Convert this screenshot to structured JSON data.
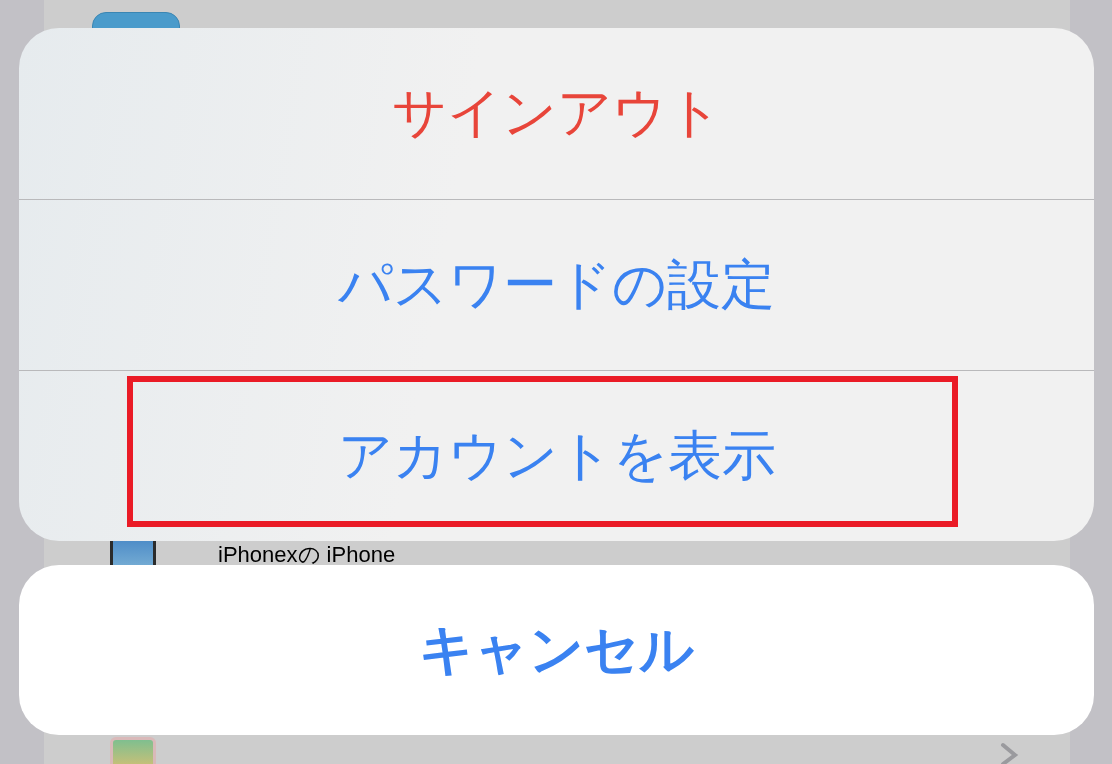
{
  "background_list": {
    "rows": [
      {
        "kind": "app",
        "name": "iPhonexの iPhone"
      },
      {
        "kind": "chevron"
      }
    ]
  },
  "action_sheet": {
    "actions": [
      {
        "label": "サインアウト",
        "kind": "destructive",
        "highlighted": false
      },
      {
        "label": "パスワードの設定",
        "kind": "default",
        "highlighted": false
      },
      {
        "label": "アカウントを表示",
        "kind": "default",
        "highlighted": true
      }
    ],
    "cancel": {
      "label": "キャンセル"
    }
  }
}
